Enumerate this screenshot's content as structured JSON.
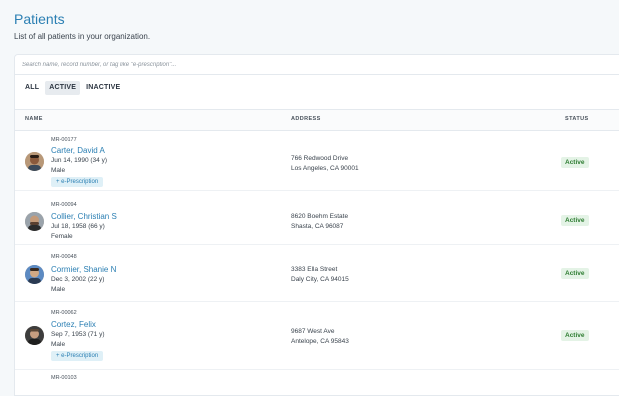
{
  "page": {
    "title": "Patients",
    "subtitle": "List of all patients in your organization."
  },
  "search": {
    "placeholder": "Search name, record number, or tag like \"e-prescription\"..."
  },
  "filters": [
    {
      "label": "ALL",
      "active": false
    },
    {
      "label": "ACTIVE",
      "active": true
    },
    {
      "label": "INACTIVE",
      "active": false
    }
  ],
  "table": {
    "columns": {
      "name": "NAME",
      "address": "ADDRESS",
      "status": "STATUS"
    },
    "rows": [
      {
        "record": "MR-00177",
        "name": "Carter, David A",
        "dob": "Jun 14, 1990 (34 y)",
        "gender": "Male",
        "tag": "+ e-Prescription",
        "address1": "766 Redwood Drive",
        "address2": "Los Angeles, CA 90001",
        "status": "Active"
      },
      {
        "record": "MR-00094",
        "name": "Collier, Christian S",
        "dob": "Jul 18, 1958 (66 y)",
        "gender": "Female",
        "tag": "",
        "address1": "8620 Boehm Estate",
        "address2": "Shasta, CA 96087",
        "status": "Active"
      },
      {
        "record": "MR-00048",
        "name": "Cormier, Shanie N",
        "dob": "Dec 3, 2002 (22 y)",
        "gender": "Male",
        "tag": "",
        "address1": "3383 Ella Street",
        "address2": "Daly City, CA 94015",
        "status": "Active"
      },
      {
        "record": "MR-00062",
        "name": "Cortez, Felix",
        "dob": "Sep 7, 1953 (71 y)",
        "gender": "Male",
        "tag": "+ e-Prescription",
        "address1": "9687 West Ave",
        "address2": "Antelope, CA 95843",
        "status": "Active"
      },
      {
        "record": "MR-00103",
        "name": "",
        "dob": "",
        "gender": "",
        "tag": "",
        "address1": "",
        "address2": "",
        "status": ""
      }
    ]
  },
  "colors": {
    "accent": "#2b7fb3",
    "status_active_bg": "#e4f3e6",
    "status_active_text": "#2e7d32",
    "tag_bg": "#dff0f7"
  }
}
